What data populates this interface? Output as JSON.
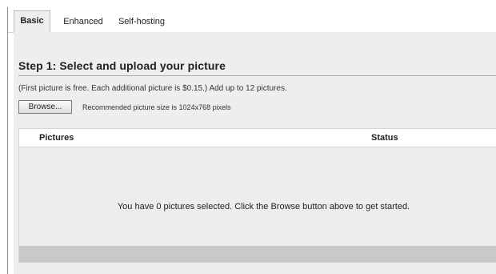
{
  "tabs": [
    {
      "label": "Basic",
      "active": true
    },
    {
      "label": "Enhanced",
      "active": false
    },
    {
      "label": "Self-hosting",
      "active": false
    }
  ],
  "step": {
    "title": "Step 1: Select and upload your picture",
    "info": "(First picture is free. Each additional picture is $0.15.) Add up to 12 pictures."
  },
  "upload": {
    "browse_label": "Browse...",
    "recommendation": "Recommended picture size is 1024x768 pixels"
  },
  "table": {
    "columns": [
      "Pictures",
      "Status"
    ],
    "empty_message": "You have 0 pictures selected. Click the Browse button above to get started."
  }
}
